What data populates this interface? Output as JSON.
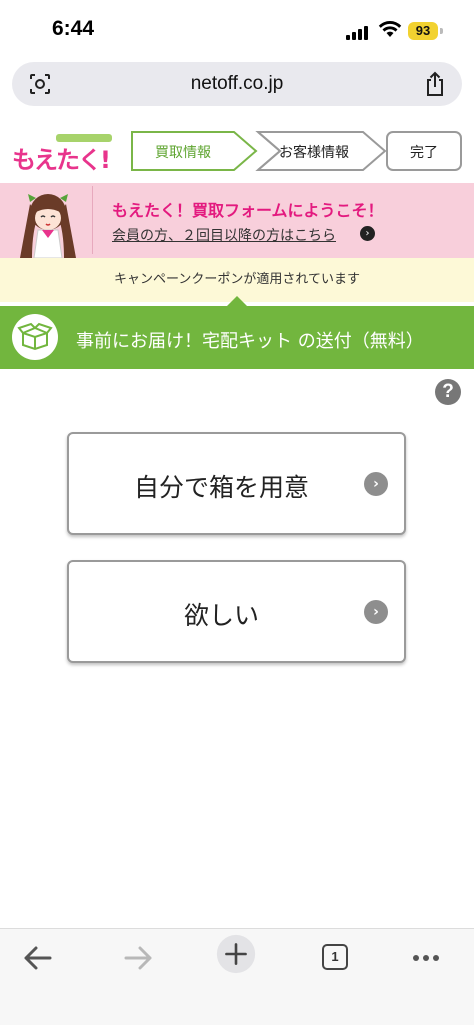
{
  "status_bar": {
    "time": "6:44",
    "battery": "93",
    "battery_color": "#f2d230"
  },
  "browser": {
    "url": "netoff.co.jp",
    "left_icon": "reader-icon",
    "share_icon": "share-icon"
  },
  "header": {
    "logo_text": "もえたく!",
    "steps": [
      {
        "label": "買取情報",
        "active": true
      },
      {
        "label": "お客様情報",
        "active": false
      },
      {
        "label": "完了",
        "active": false
      }
    ],
    "active_color": "#7ab648"
  },
  "banner": {
    "title": "もえたく！買取フォームにようこそ！",
    "link": "会員の方、２回目以降の方はこちら",
    "title_color": "#e31a7f",
    "background": "#f8cfdb"
  },
  "coupon": {
    "text": "キャンペーンクーポンが適用されています",
    "background": "#fdf9d7"
  },
  "section": {
    "title": "事前にお届け！宅配キット の送付（無料）",
    "icon": "box-icon",
    "background": "#72b63e"
  },
  "help": {
    "label": "?"
  },
  "options": [
    {
      "label": "自分で箱を用意"
    },
    {
      "label": "欲しい"
    }
  ],
  "bottom_nav": {
    "back_icon": "back-arrow-icon",
    "forward_icon": "forward-arrow-icon",
    "new_tab_icon": "plus-icon",
    "tab_count": "1",
    "more_icon": "more-icon"
  }
}
